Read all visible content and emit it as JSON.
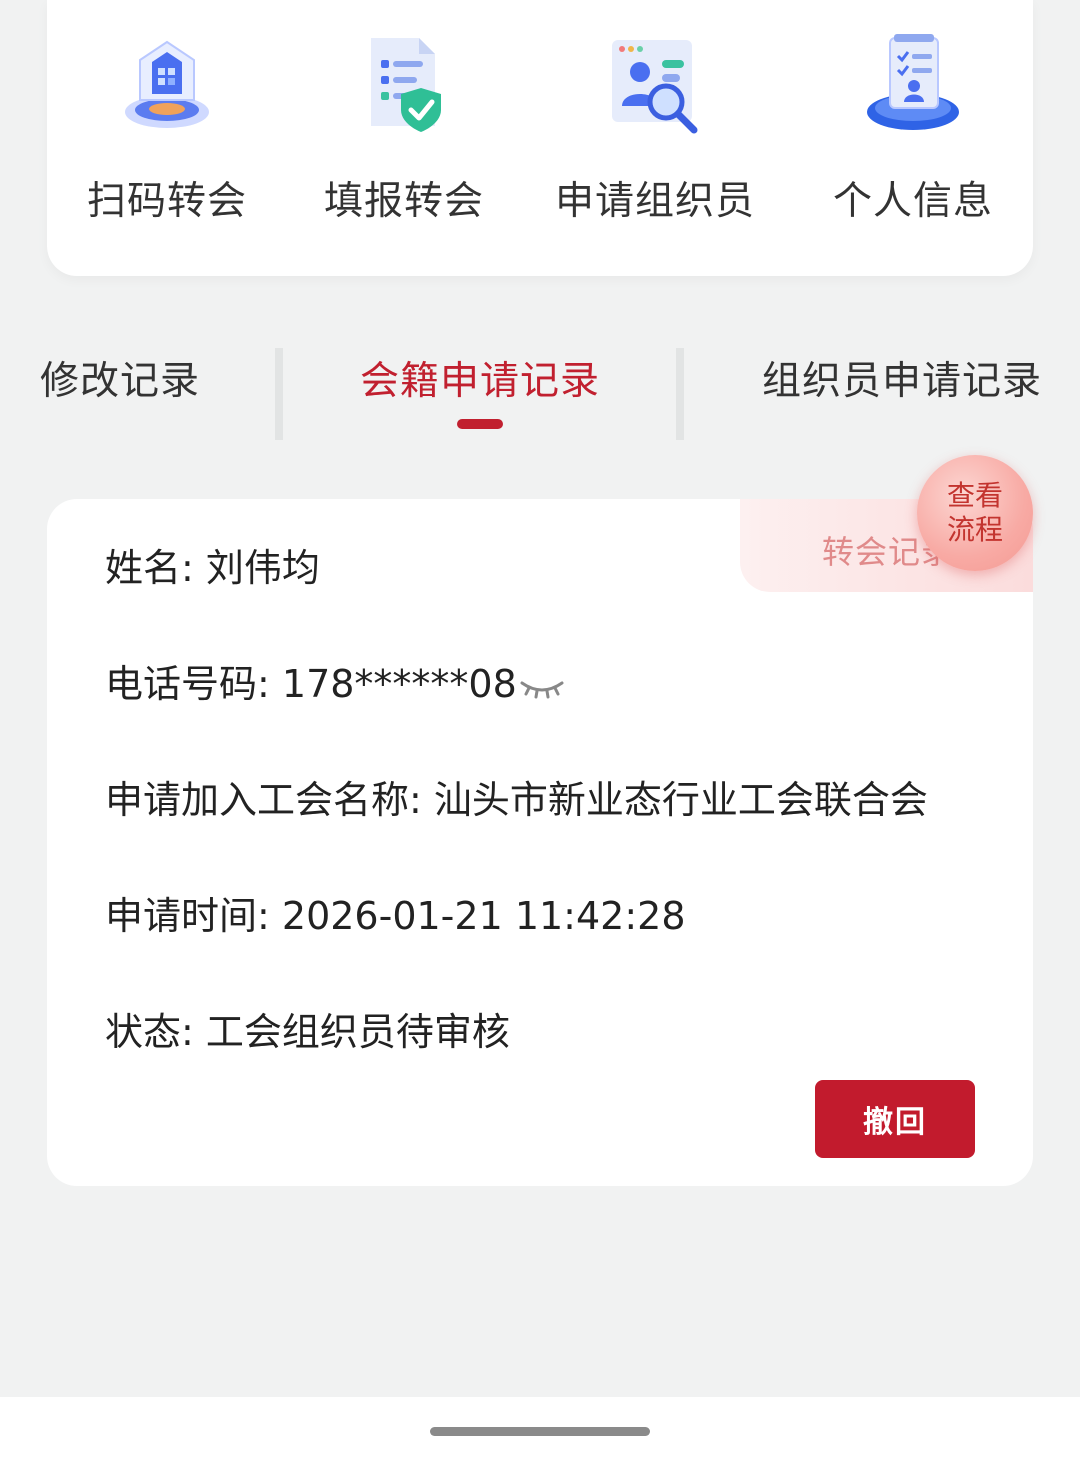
{
  "shortcuts": [
    {
      "label": "扫码转会",
      "icon": "scan-transfer-icon"
    },
    {
      "label": "填报转会",
      "icon": "form-transfer-icon"
    },
    {
      "label": "申请组织员",
      "icon": "apply-organizer-icon"
    },
    {
      "label": "个人信息",
      "icon": "personal-info-icon"
    }
  ],
  "tabs": [
    {
      "label": "修改记录",
      "active": false
    },
    {
      "label": "会籍申请记录",
      "active": true
    },
    {
      "label": "组织员申请记录",
      "active": false
    }
  ],
  "record": {
    "tag": "转会记录",
    "name_label": "姓名:",
    "name_value": "刘伟均",
    "phone_label": "电话号码:",
    "phone_value": "178******08",
    "union_label": "申请加入工会名称:",
    "union_value": "汕头市新业态行业工会联合会",
    "time_label": "申请时间:",
    "time_value": "2026-01-21 11:42:28",
    "status_label": "状态:",
    "status_value": "工会组织员待审核",
    "revoke_label": "撤回"
  },
  "fab": {
    "label": "查看流程"
  },
  "colors": {
    "accent": "#c1202f",
    "background": "#f1f2f2",
    "card": "#ffffff"
  }
}
